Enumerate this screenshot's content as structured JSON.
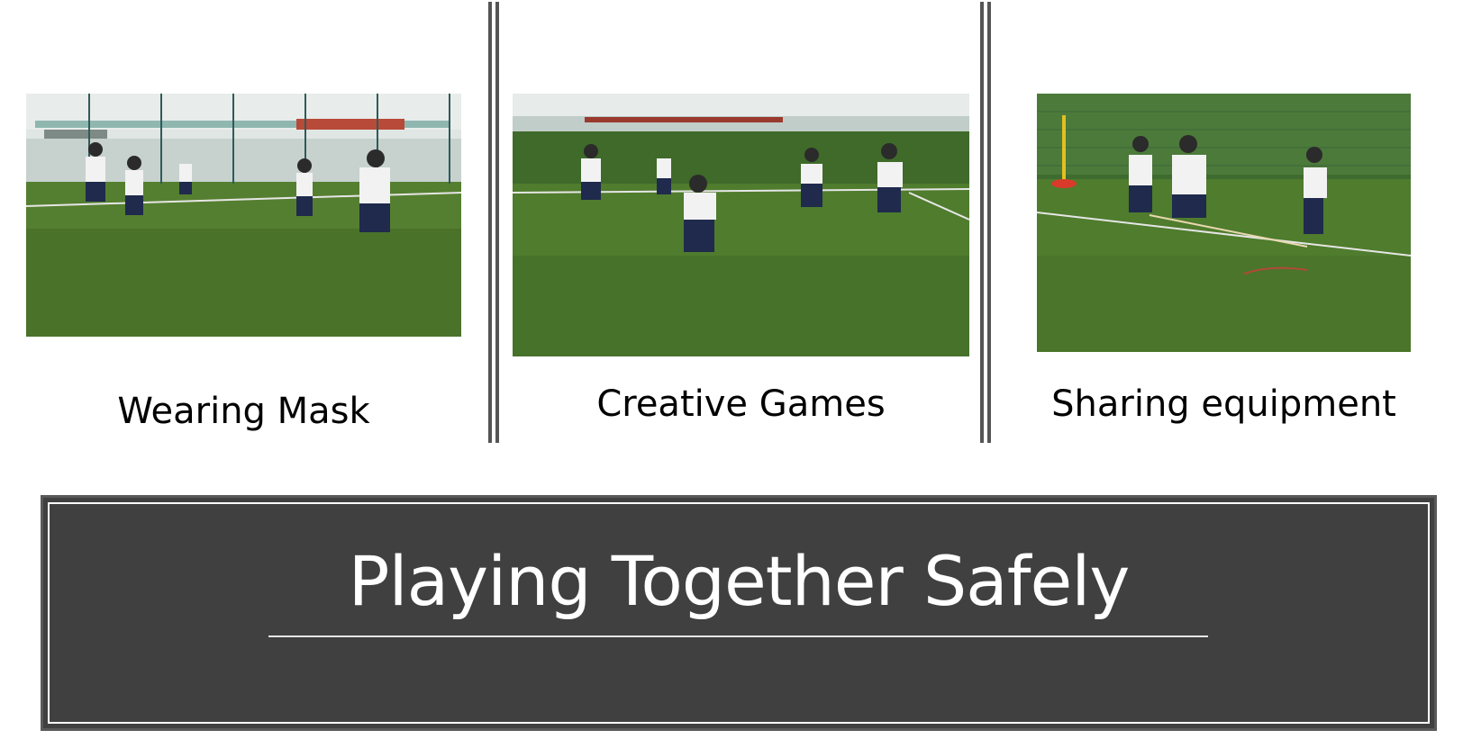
{
  "slide": {
    "title": "Playing Together Safely",
    "panels": [
      {
        "caption": "Wearing Mask",
        "image": "students-playing-ball-on-field-photo"
      },
      {
        "caption": "Creative Games",
        "image": "students-playing-game-on-field-photo"
      },
      {
        "caption": "Sharing equipment",
        "image": "students-sharing-rope-on-field-photo"
      }
    ]
  },
  "colors": {
    "title_panel": "#404040",
    "title_text": "#ffffff",
    "divider": "#555555",
    "grass": "#4f7a2e",
    "uniform_shirt": "#f2f2f2",
    "uniform_shorts": "#1f2a4d"
  }
}
